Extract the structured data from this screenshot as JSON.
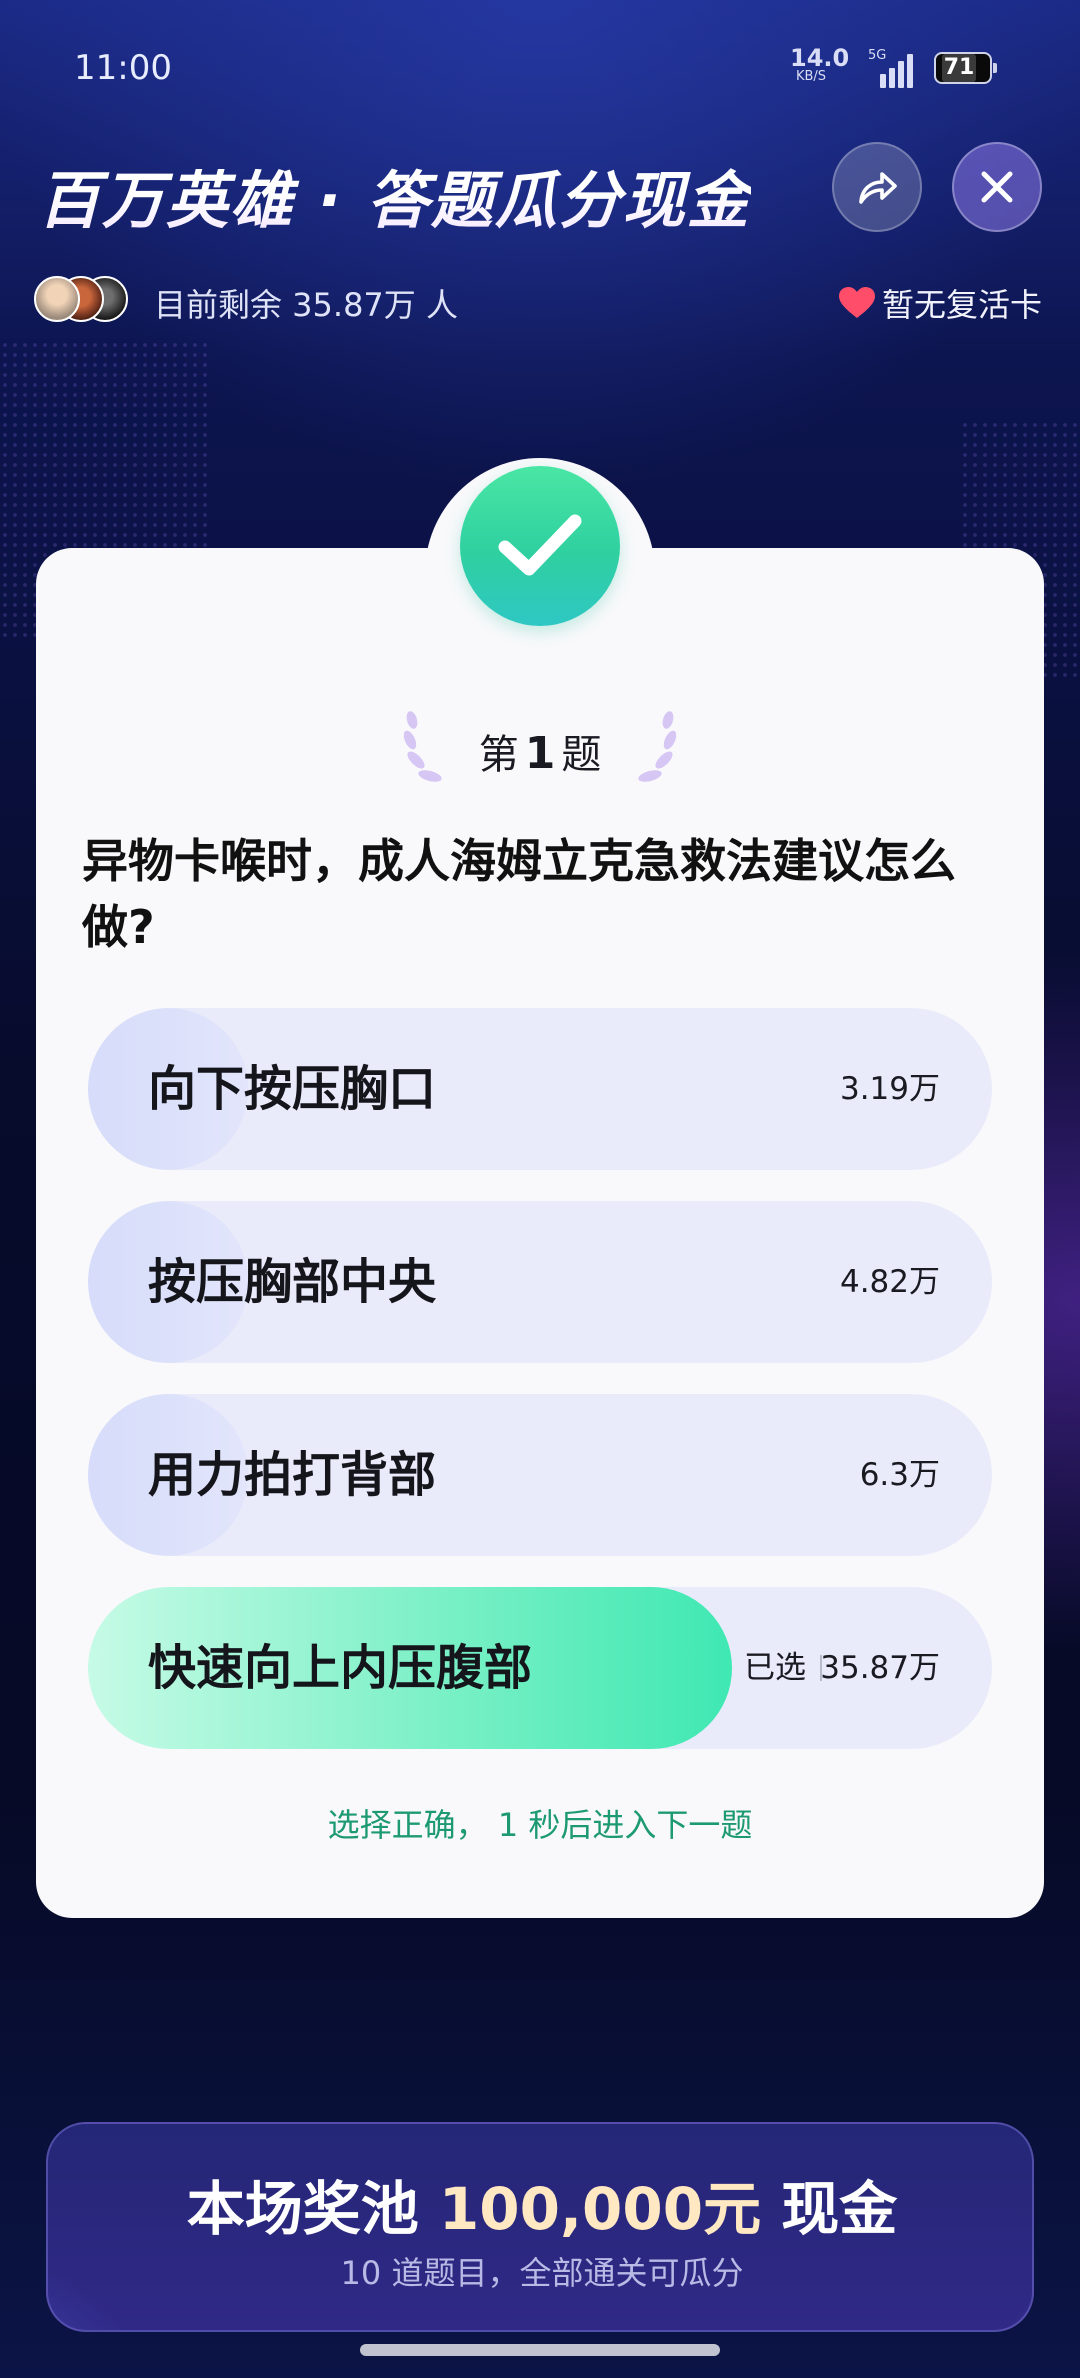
{
  "status_bar": {
    "time": "11:00",
    "net_speed_value": "14.0",
    "net_speed_unit": "KB/S",
    "network_type": "5G",
    "battery": "71"
  },
  "header": {
    "title": "百万英雄 · 答题瓜分现金",
    "share_icon": "share-icon",
    "close_icon": "close-icon"
  },
  "info": {
    "remaining_label": "目前剩余 35.87万 人",
    "revive_label": "暂无复活卡",
    "heart_color": "#ff4d6a"
  },
  "question": {
    "number_prefix": "第",
    "number": "1",
    "number_suffix": "题",
    "text": "异物卡喉时，成人海姆立克急救法建议怎么做?",
    "options": [
      {
        "label": "向下按压胸口",
        "count": "3.19万"
      },
      {
        "label": "按压胸部中央",
        "count": "4.82万"
      },
      {
        "label": "用力拍打背部",
        "count": "6.3万"
      },
      {
        "label": "快速向上内压腹部",
        "count": "35.87万",
        "selected_text": "已选",
        "selected": true
      }
    ],
    "result_hint": "选择正确， 1 秒后进入下一题",
    "correct_color": "#3fdc9c"
  },
  "prize_pool": {
    "title_prefix": "本场奖池",
    "amount": "100,000元",
    "title_suffix": "现金",
    "subtitle": "10 道题目，全部通关可瓜分"
  }
}
